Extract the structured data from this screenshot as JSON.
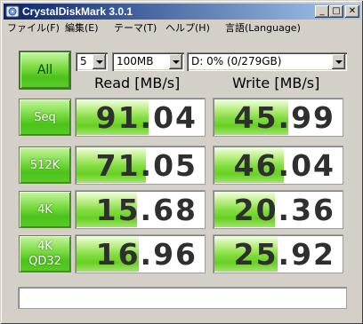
{
  "window": {
    "title": "CrystalDiskMark 3.0.1",
    "min_glyph": "_",
    "max_glyph": "□",
    "close_glyph": "✕"
  },
  "menu": [
    {
      "label": "ファイル(F)"
    },
    {
      "label": "編集(E)"
    },
    {
      "label": "テーマ(T)"
    },
    {
      "label": "ヘルプ(H)"
    },
    {
      "label": "言語(Language)"
    }
  ],
  "controls": {
    "all_label": "All",
    "count_value": "5",
    "size_value": "100MB",
    "drive_value": "D: 0% (0/279GB)"
  },
  "headers": {
    "read": "Read [MB/s]",
    "write": "Write [MB/s]"
  },
  "rows": [
    {
      "label": "Seq",
      "read": "91.04",
      "write": "45.99",
      "read_fill": 0.56,
      "write_fill": 0.57
    },
    {
      "label": "512K",
      "read": "71.05",
      "write": "46.04",
      "read_fill": 0.54,
      "write_fill": 0.54
    },
    {
      "label": "4K",
      "read": "15.68",
      "write": "20.36",
      "read_fill": 0.47,
      "write_fill": 0.47
    },
    {
      "label": "4K\nQD32",
      "read": "16.96",
      "write": "25.92",
      "read_fill": 0.48,
      "write_fill": 0.49
    }
  ],
  "status_text": "",
  "colors": {
    "title_start": "#0a246a",
    "title_end": "#a6caf0",
    "button_green": "#5acb27",
    "bar_green": "#7edc3a",
    "face": "#d4d0c8"
  },
  "icons": {
    "app": "crystaldiskmark-app-icon",
    "dropdown": "chevron-down-icon"
  }
}
